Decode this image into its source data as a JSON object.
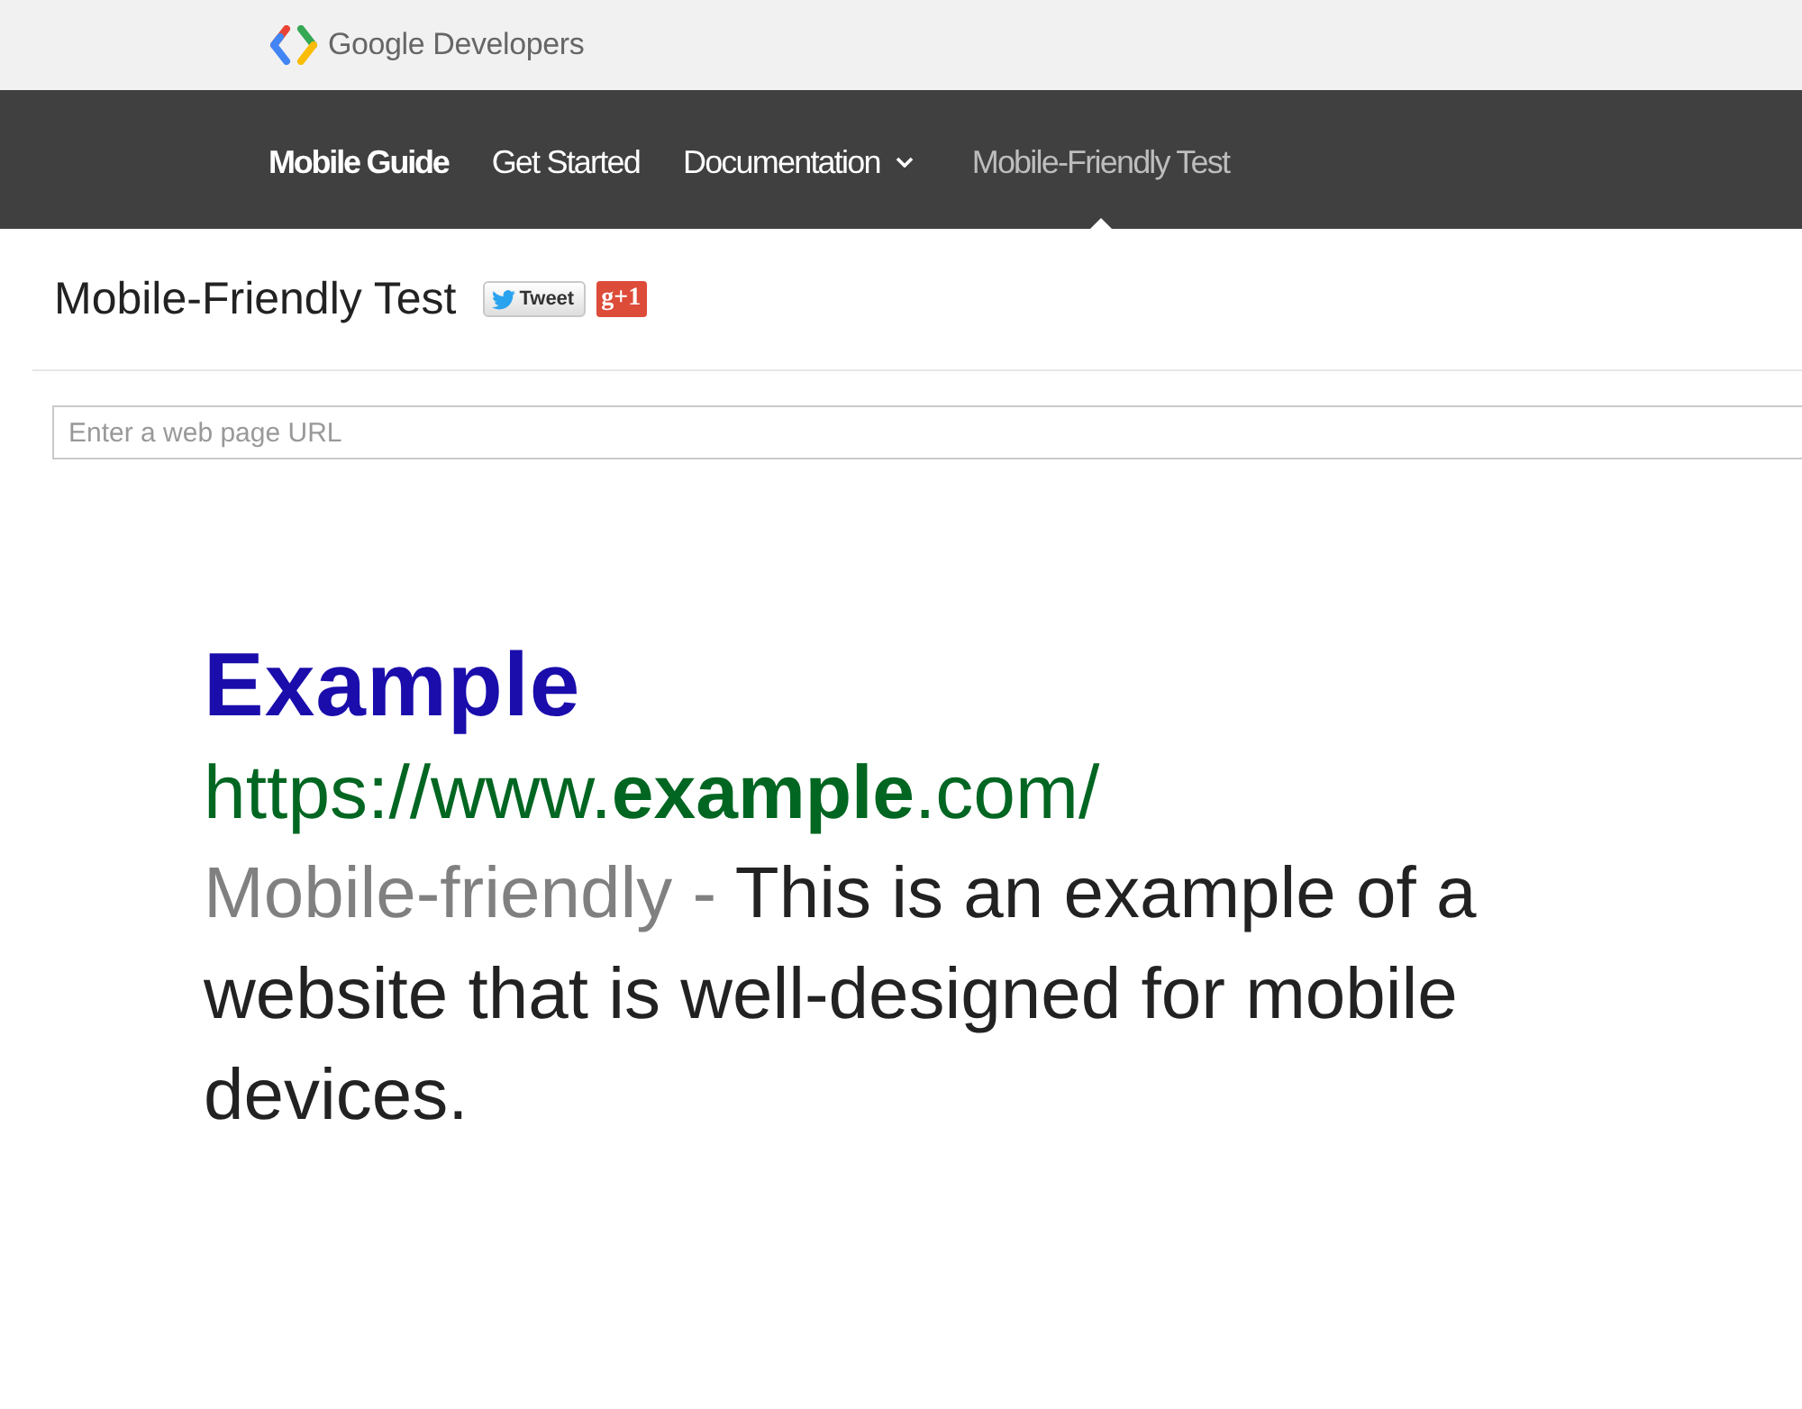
{
  "header": {
    "brand": "Google Developers"
  },
  "nav": {
    "section": "Mobile Guide",
    "items": [
      {
        "label": "Get Started",
        "selected": false,
        "dropdown": false
      },
      {
        "label": "Documentation",
        "selected": false,
        "dropdown": true
      },
      {
        "label": "Mobile-Friendly Test",
        "selected": true,
        "dropdown": false
      }
    ]
  },
  "page": {
    "title": "Mobile-Friendly Test",
    "share_buttons": [
      {
        "kind": "tweet",
        "label": "Tweet"
      },
      {
        "kind": "plus_one",
        "label": "g+1"
      }
    ]
  },
  "url_field": {
    "placeholder": "Enter a web page URL"
  },
  "example_result": {
    "title": "Example",
    "url": "https://www.**example**.com/",
    "label": "Mobile-friendly -",
    "snippet": "This is an example of a website that is well-designed for mobile devices."
  }
}
